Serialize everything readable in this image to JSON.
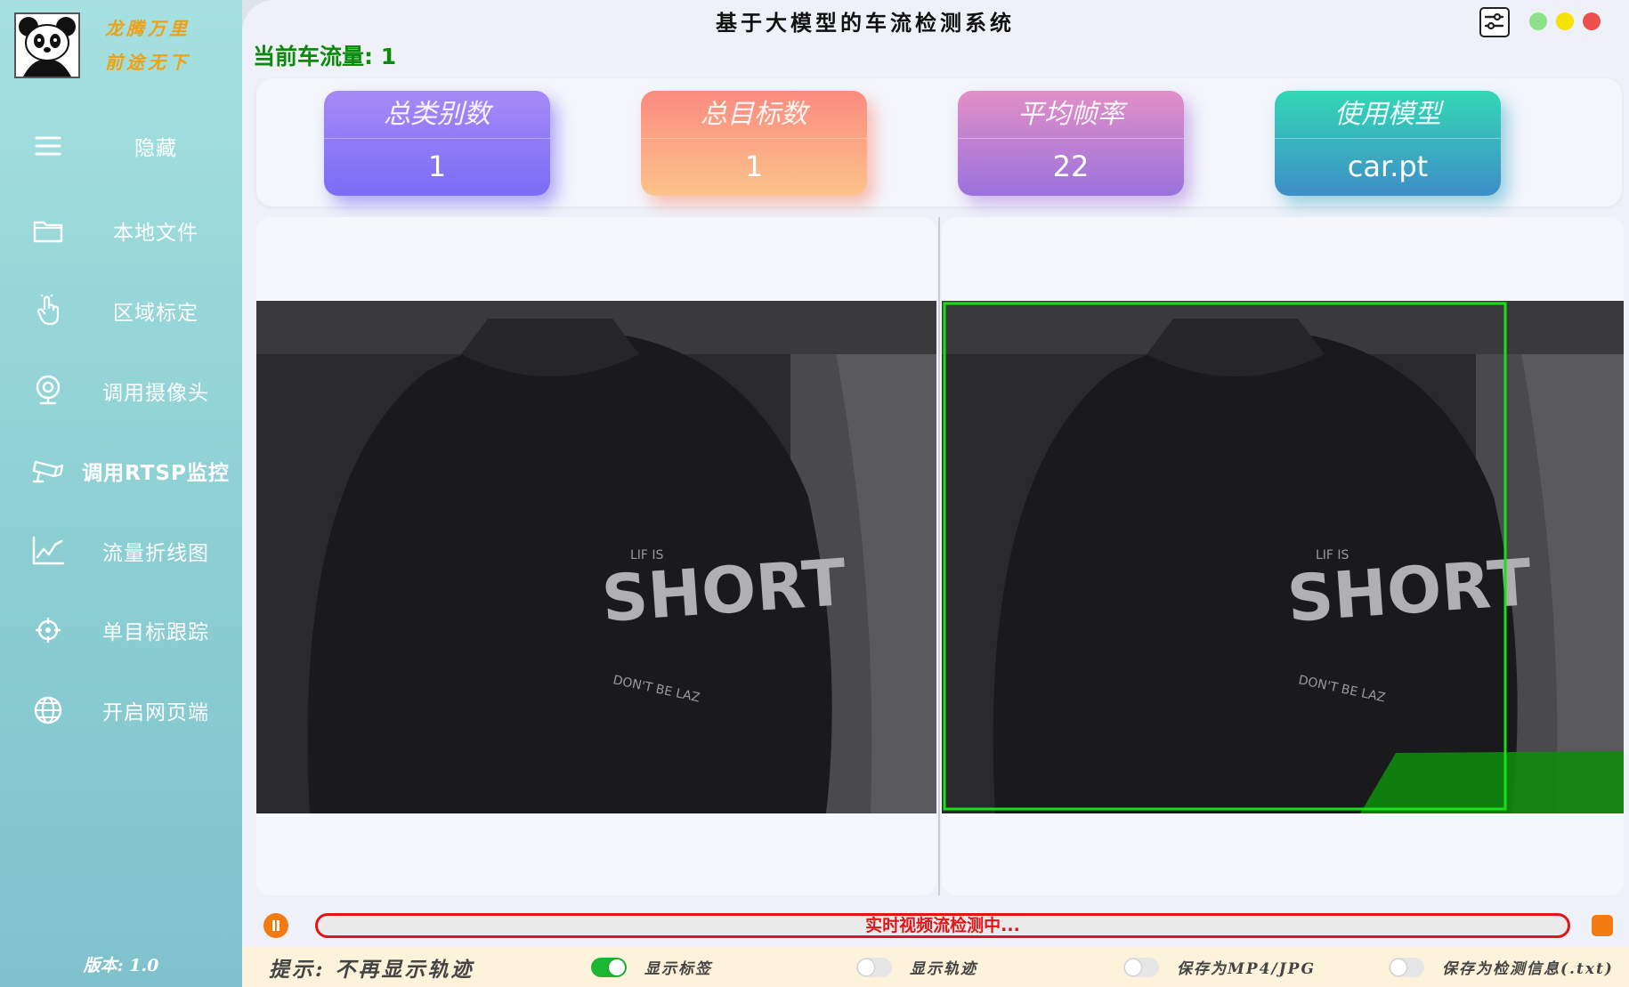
{
  "sidebar": {
    "brand_line1": "龙腾万里",
    "brand_line2": "前途无下",
    "items": [
      {
        "label": "隐藏",
        "icon": "menu-icon"
      },
      {
        "label": "本地文件",
        "icon": "folder-icon"
      },
      {
        "label": "区域标定",
        "icon": "hand-pointer-icon"
      },
      {
        "label": "调用摄像头",
        "icon": "webcam-icon"
      },
      {
        "label": "调用RTSP监控",
        "icon": "cctv-camera-icon"
      },
      {
        "label": "流量折线图",
        "icon": "line-chart-icon"
      },
      {
        "label": "单目标跟踪",
        "icon": "crosshair-icon"
      },
      {
        "label": "开启网页端",
        "icon": "globe-icon"
      }
    ],
    "version": "版本: 1.0"
  },
  "header": {
    "title": "基于大模型的车流检测系统",
    "flow_count_label": "当前车流量: 1"
  },
  "window_controls": [
    "settings-icon",
    "minimize-dot",
    "maximize-dot",
    "close-dot"
  ],
  "colors": {
    "sidebar": "#8ccfd3",
    "accent_green": "#0c8a0c",
    "progress_red": "#e0151a",
    "control_orange": "#f37a10",
    "detection_box": "#18e018"
  },
  "cards": [
    {
      "title": "总类别数",
      "value": "1"
    },
    {
      "title": "总目标数",
      "value": "1"
    },
    {
      "title": "平均帧率",
      "value": "22"
    },
    {
      "title": "使用模型",
      "value": "car.pt"
    }
  ],
  "status": {
    "progress_text": "实时视频流检测中..."
  },
  "footer": {
    "tip": "提示: 不再显示轨迹",
    "toggles": [
      {
        "label": "显示标签",
        "on": true
      },
      {
        "label": "显示轨迹",
        "on": false
      },
      {
        "label": "保存为MP4/JPG",
        "on": false
      },
      {
        "label": "保存为检测信息(.txt)",
        "on": false
      }
    ]
  }
}
